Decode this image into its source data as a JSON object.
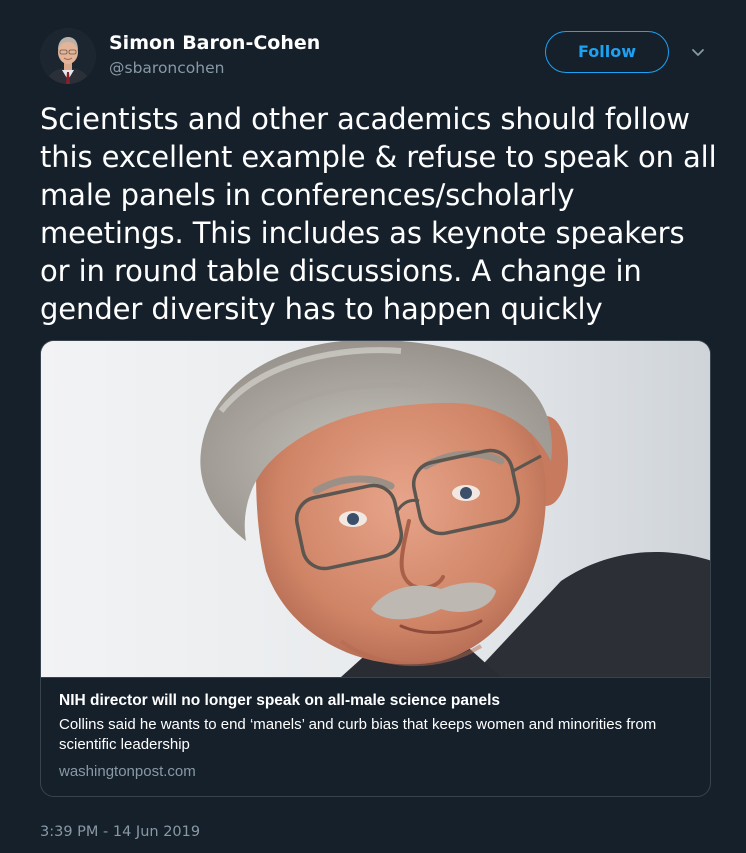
{
  "author": {
    "display_name": "Simon Baron-Cohen",
    "handle": "@sbaroncohen"
  },
  "header": {
    "follow_label": "Follow",
    "more_icon": "chevron-down-icon"
  },
  "tweet": {
    "text": "Scientists and other academics should follow this excellent example & refuse to speak on all male panels in conferences/scholarly meetings. This includes as keynote speakers or in round table discussions. A change in gender diversity has to happen quickly",
    "timestamp": "3:39 PM - 14 Jun 2019"
  },
  "card": {
    "title": "NIH director will no longer speak on all-male science panels",
    "description": "Collins said he wants to end ‘manels’ and curb bias that keeps women and minorities from scientific leadership",
    "domain": "washingtonpost.com"
  },
  "colors": {
    "background": "#15202b",
    "accent": "#1da1f2",
    "secondary_text": "#8899a6",
    "border": "#38444d"
  }
}
